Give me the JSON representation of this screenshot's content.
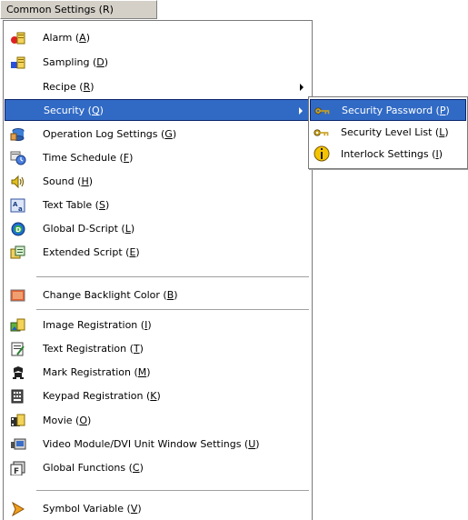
{
  "menubar": {
    "label": "Common Settings (R)"
  },
  "main_menu": {
    "items": [
      {
        "label": "Alarm (",
        "key": "A",
        "end": ")",
        "icon": "alarm-icon"
      },
      {
        "label": "Sampling (",
        "key": "D",
        "end": ")",
        "icon": "sampling-icon"
      },
      {
        "label": "Recipe (",
        "key": "R",
        "end": ")",
        "icon": "",
        "submenu": true
      },
      {
        "label": "Security (",
        "key": "Q",
        "end": ")",
        "icon": "",
        "submenu": true,
        "highlighted": true
      },
      {
        "label": "Operation Log Settings (",
        "key": "G",
        "end": ")",
        "icon": "operation-log-icon"
      },
      {
        "label": "Time Schedule (",
        "key": "F",
        "end": ")",
        "icon": "time-schedule-icon"
      },
      {
        "label": "Sound (",
        "key": "H",
        "end": ")",
        "icon": "sound-icon"
      },
      {
        "label": "Text Table (",
        "key": "S",
        "end": ")",
        "icon": "text-table-icon"
      },
      {
        "label": "Global D-Script (",
        "key": "L",
        "end": ")",
        "icon": "global-dscript-icon"
      },
      {
        "label": "Extended Script (",
        "key": "E",
        "end": ")",
        "icon": "extended-script-icon"
      },
      {
        "label": "Change Backlight Color (",
        "key": "B",
        "end": ")",
        "icon": "backlight-icon"
      },
      {
        "label": "Image Registration (",
        "key": "I",
        "end": ")",
        "icon": "image-registration-icon"
      },
      {
        "label": "Text Registration (",
        "key": "T",
        "end": ")",
        "icon": "text-registration-icon"
      },
      {
        "label": "Mark Registration (",
        "key": "M",
        "end": ")",
        "icon": "mark-registration-icon"
      },
      {
        "label": "Keypad Registration (",
        "key": "K",
        "end": ")",
        "icon": "keypad-registration-icon"
      },
      {
        "label": "Movie (",
        "key": "O",
        "end": ")",
        "icon": "movie-icon"
      },
      {
        "label": "Video Module/DVI Unit Window Settings (",
        "key": "U",
        "end": ")",
        "icon": "video-module-icon"
      },
      {
        "label": "Global Functions (",
        "key": "C",
        "end": ")",
        "icon": "global-functions-icon"
      },
      {
        "label": "Symbol Variable (",
        "key": "V",
        "end": ")",
        "icon": "symbol-variable-icon"
      }
    ]
  },
  "security_submenu": {
    "items": [
      {
        "label": "Security Password (",
        "key": "P",
        "end": ")",
        "icon": "key-icon",
        "highlighted": true
      },
      {
        "label": "Security Level List (",
        "key": "L",
        "end": ")",
        "icon": "key-icon"
      },
      {
        "label": "Interlock Settings (",
        "key": "I",
        "end": ")",
        "icon": "info-icon"
      }
    ]
  },
  "colors": {
    "highlight": "#316ac5",
    "menubar": "#d4d0c8"
  }
}
